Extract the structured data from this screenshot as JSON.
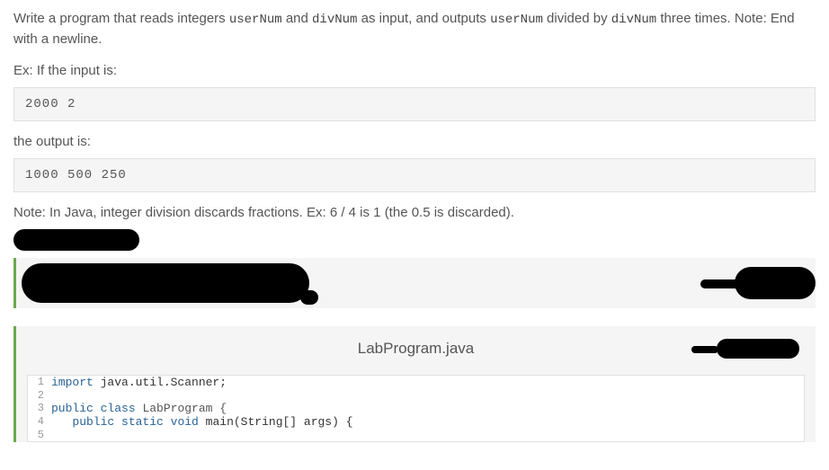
{
  "description": {
    "part1": "Write a program that reads integers ",
    "var1": "userNum",
    "part2": " and ",
    "var2": "divNum",
    "part3": " as input, and outputs ",
    "var3": "userNum",
    "part4": " divided by ",
    "var4": "divNum",
    "part5": " three times. Note: End with a newline."
  },
  "example": {
    "intro": "Ex: If the input is:",
    "input": "2000 2",
    "outputLabel": "the output is:",
    "output": "1000 500 250"
  },
  "note": "Note: In Java, integer division discards fractions. Ex: 6 / 4 is 1 (the 0.5 is discarded).",
  "editor": {
    "filename": "LabProgram.java",
    "lines": {
      "1": {
        "num": "1",
        "import": "import",
        "rest": " java.util.Scanner;"
      },
      "2": {
        "num": "2",
        "content": ""
      },
      "3": {
        "num": "3",
        "public": "public",
        "class": "class",
        "name": " LabProgram {"
      },
      "4": {
        "num": "4",
        "public": "public",
        "static": "static",
        "void": "void",
        "rest": " main(String[] args) {"
      },
      "5": {
        "num": "5",
        "content": ""
      }
    }
  }
}
